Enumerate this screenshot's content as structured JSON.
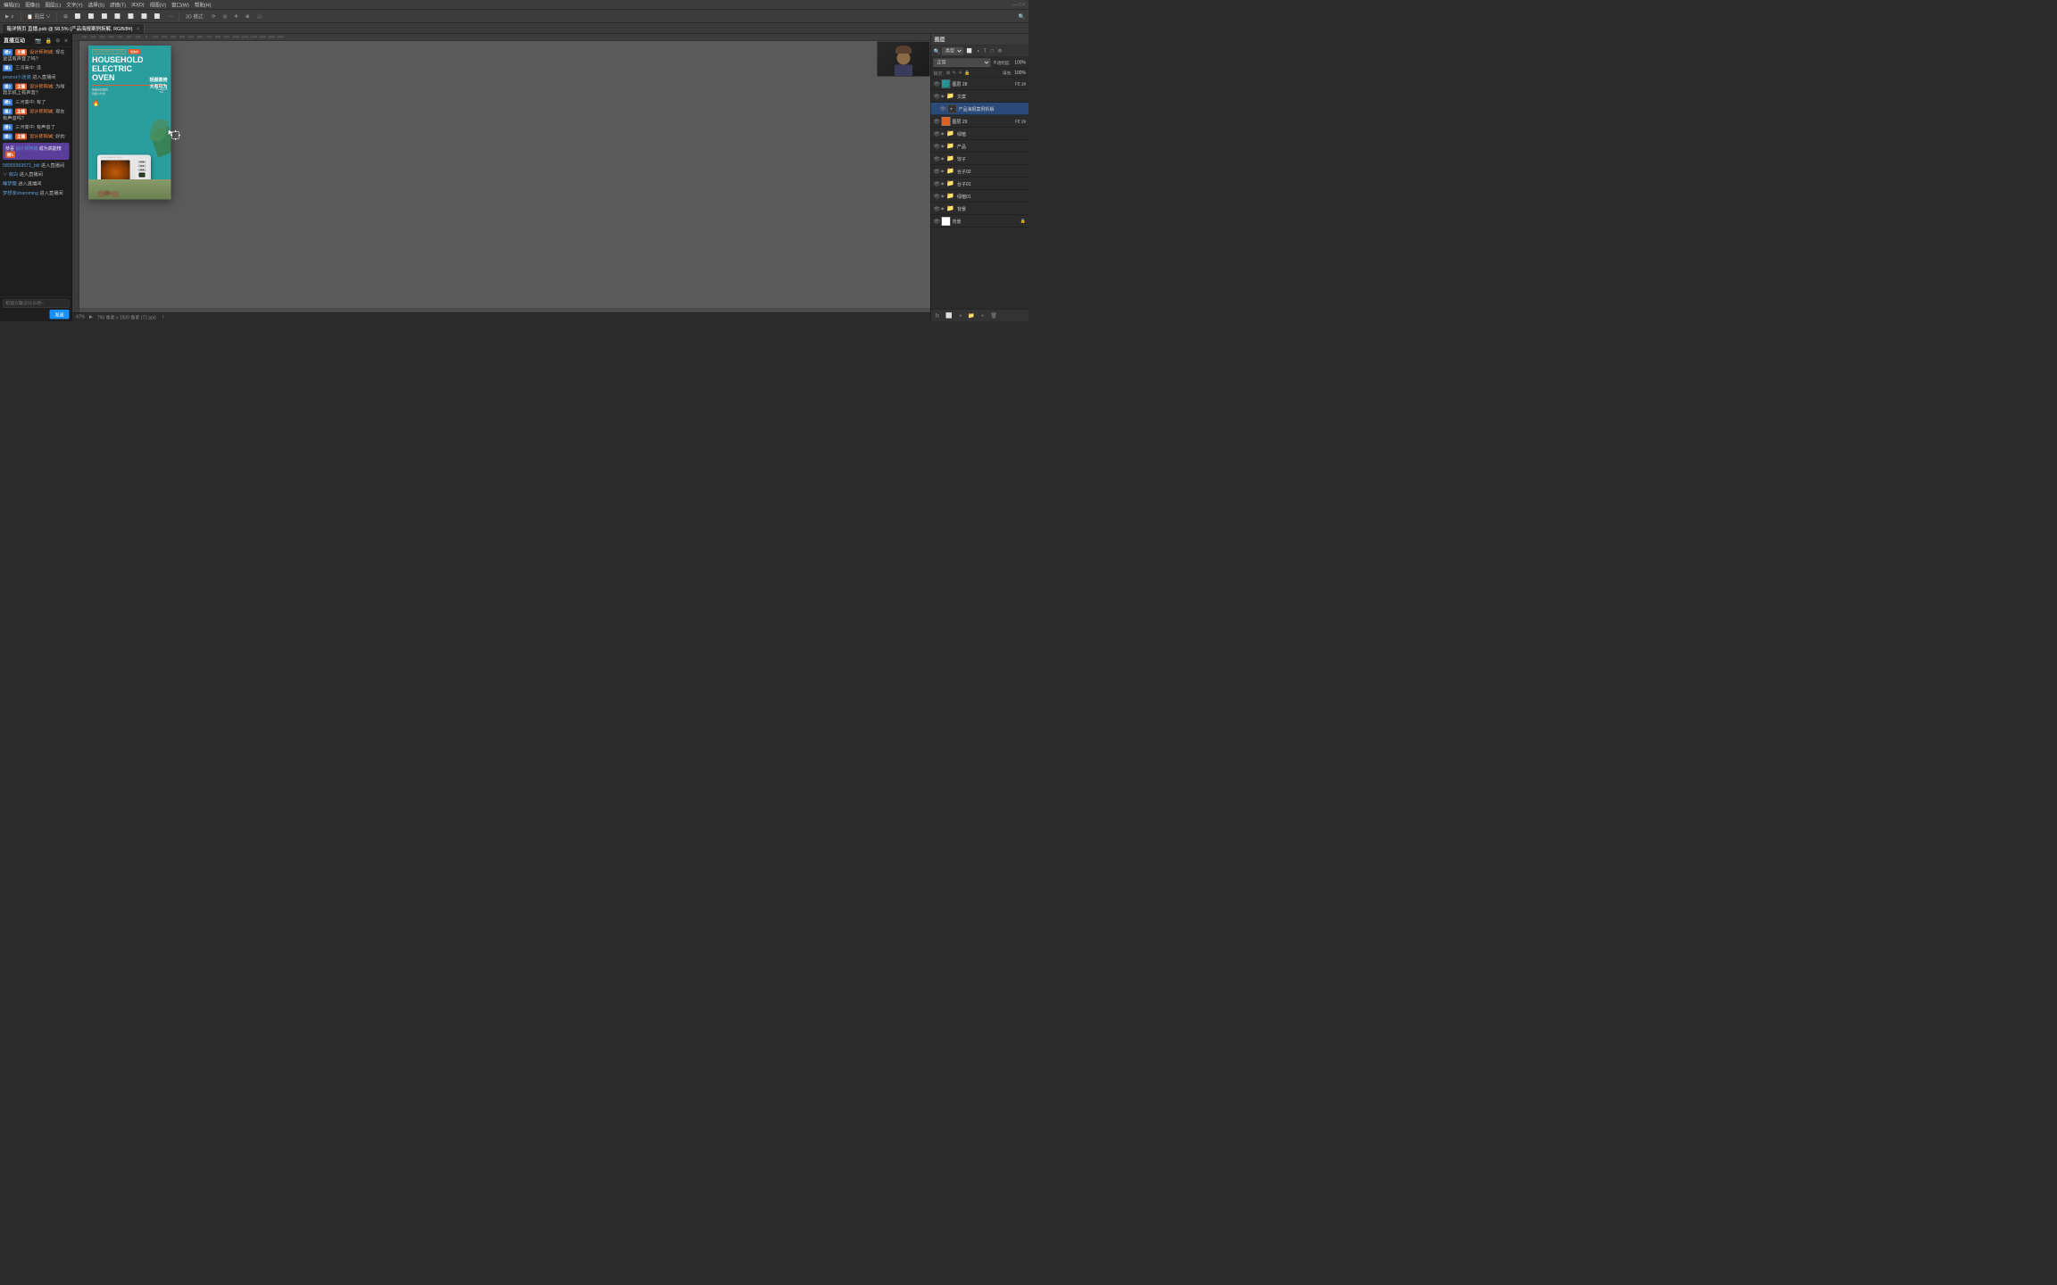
{
  "app": {
    "title": "Photoshop",
    "menu_items": [
      "编辑(E)",
      "图像(I)",
      "图层(L)",
      "文字(Y)",
      "选择(S)",
      "滤镜(T)",
      "3D(D)",
      "视图(V)",
      "窗口(W)",
      "帮助(H)"
    ]
  },
  "tab": {
    "label": "箱详情页 直播.psb @ 58.5% (产品海报案例拆解, RGB/8#)",
    "close": "×"
  },
  "toolbar": {
    "3d_mode": "3D 模式:",
    "layer_dropdown": "图层"
  },
  "status_bar": {
    "zoom": "47%",
    "dimensions": "790 像素 x 1500 像素 (72 ppi)"
  },
  "live_panel": {
    "title": "直播互动",
    "messages": [
      {
        "id": 1,
        "badge": "楼2",
        "badge_type": "anchor",
        "sub_badge": "主播",
        "username": "设计师阿城",
        "text": "现在说话有声音了吗?"
      },
      {
        "id": 2,
        "badge": "楼1",
        "badge_type": "lv1",
        "username": "三河秦中",
        "text": "没"
      },
      {
        "id": 3,
        "type": "enter",
        "username": "peanut小迷弟",
        "text": "进入直播间"
      },
      {
        "id": 4,
        "badge": "楼2",
        "badge_type": "anchor",
        "sub_badge": "主播",
        "username": "设计师阿城",
        "text": "为啥我手机上有声音?"
      },
      {
        "id": 5,
        "badge": "楼1",
        "badge_type": "lv1",
        "username": "三河秦中",
        "text": "有了"
      },
      {
        "id": 6,
        "badge": "楼2",
        "badge_type": "anchor",
        "sub_badge": "主播",
        "username": "设计师阿城",
        "text": "现在有声音吗?"
      },
      {
        "id": 7,
        "badge": "楼1",
        "badge_type": "lv1",
        "username": "三河秦中",
        "text": "有声音了"
      },
      {
        "id": 8,
        "badge": "楼2",
        "badge_type": "anchor",
        "sub_badge": "主播",
        "username": "设计师阿城",
        "text": "好的"
      }
    ],
    "highlight": {
      "prefix": "恭喜",
      "username": "设计师阿城",
      "action": "成为高能榜",
      "badge": "榜1"
    },
    "enter_messages": [
      {
        "username": "58955569571_bili",
        "text": "进入直播间"
      },
      {
        "username": "∨ 叙白",
        "text": "进入直播间"
      },
      {
        "username": "睡梦狸",
        "text": "进入直播间"
      },
      {
        "username": "梦想家shamming",
        "text": "进入直播间"
      }
    ],
    "input_placeholder": "和观众聊点什么吧~",
    "send_label": "发送"
  },
  "canvas": {
    "ruler_marks": [
      "-700",
      "-600",
      "-500",
      "-400",
      "-300",
      "-200",
      "-100",
      "0",
      "100",
      "200",
      "300",
      "400",
      "500",
      "600",
      "700",
      "800",
      "900",
      "1000",
      "1100",
      "1200",
      "1300",
      "1400",
      "1500"
    ]
  },
  "poster": {
    "tag_en": "MICROWAVE 5000",
    "tag_cn": "微波炉",
    "title_line1": "HOUSEHOLD",
    "title_line2": "ELECTRIC",
    "title_line3": "OVEN",
    "cn_line1": "轻颜蒸烤",
    "cn_line2": "大有可为",
    "subtitle_left_line1": "带美食套餐的",
    "subtitle_left_line2": "智能小伙伴",
    "subtitle_right_line1": "Intelligent",
    "subtitle_right_line2": "fire"
  },
  "layers_panel": {
    "title": "图层",
    "search_placeholder": "类型",
    "blend_mode": "正常",
    "opacity_label": "不透明度:",
    "opacity_value": "100%",
    "lock_label": "锁定:",
    "fill_label": "填充:",
    "fill_value": "100%",
    "layers": [
      {
        "id": 1,
        "name": "图层 28",
        "type": "image",
        "visible": true,
        "thumb": "image",
        "selected": false,
        "fe_label": "FE 28"
      },
      {
        "id": 2,
        "name": "文案",
        "type": "folder",
        "visible": true,
        "thumb": "folder",
        "selected": false,
        "indent": 1
      },
      {
        "id": 3,
        "name": "产品海报案例拆解",
        "type": "text",
        "visible": true,
        "thumb": "text",
        "selected": true
      },
      {
        "id": 4,
        "name": "图层 29",
        "type": "solid",
        "visible": true,
        "thumb": "orange",
        "selected": false,
        "fe_label": "FE 29"
      },
      {
        "id": 5,
        "name": "绿植",
        "type": "folder",
        "visible": true,
        "thumb": "folder",
        "selected": false
      },
      {
        "id": 6,
        "name": "产品",
        "type": "folder",
        "visible": true,
        "thumb": "folder",
        "selected": false
      },
      {
        "id": 7,
        "name": "饺子",
        "type": "folder",
        "visible": true,
        "thumb": "folder",
        "selected": false
      },
      {
        "id": 8,
        "name": "台子02",
        "type": "folder",
        "visible": true,
        "thumb": "folder",
        "selected": false
      },
      {
        "id": 9,
        "name": "台子01",
        "type": "folder",
        "visible": true,
        "thumb": "folder",
        "selected": false
      },
      {
        "id": 10,
        "name": "绿植01",
        "type": "folder",
        "visible": true,
        "thumb": "folder",
        "selected": false
      },
      {
        "id": 11,
        "name": "背景",
        "type": "folder",
        "visible": true,
        "thumb": "folder",
        "selected": false
      },
      {
        "id": 12,
        "name": "背景",
        "type": "solid",
        "visible": true,
        "thumb": "white",
        "selected": false,
        "locked": true
      }
    ]
  }
}
